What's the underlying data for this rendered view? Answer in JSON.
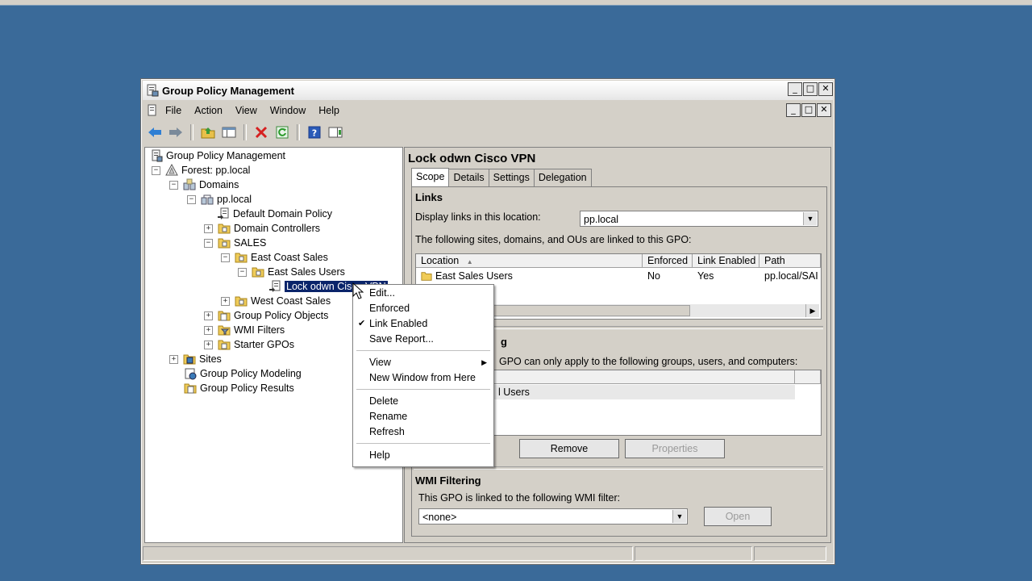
{
  "window": {
    "title": "Group Policy Management",
    "min": "_",
    "max": "□",
    "close": "✕"
  },
  "menu": {
    "items": [
      "File",
      "Action",
      "View",
      "Window",
      "Help"
    ]
  },
  "tree": {
    "root": "Group Policy Management",
    "forest": "Forest: pp.local",
    "domains": "Domains",
    "domain": "pp.local",
    "default_policy": "Default Domain Policy",
    "domain_controllers": "Domain Controllers",
    "sales": "SALES",
    "east_coast": "East Coast Sales",
    "east_users": "East Sales Users",
    "selected_gpo": "Lock odwn Cisco VPN",
    "west_coast": "West Coast Sales",
    "gpo_objects": "Group Policy Objects",
    "wmi_filters": "WMI Filters",
    "starter_gpos": "Starter GPOs",
    "sites": "Sites",
    "modeling": "Group Policy Modeling",
    "results": "Group Policy Results",
    "expanders": {
      "minus": "−",
      "plus": "+"
    }
  },
  "detail": {
    "title": "Lock odwn Cisco VPN",
    "tabs": [
      "Scope",
      "Details",
      "Settings",
      "Delegation"
    ],
    "links": {
      "heading": "Links",
      "display_label": "Display links in this location:",
      "location_value": "pp.local",
      "info": "The following sites, domains, and OUs are linked to this GPO:",
      "columns": [
        "Location",
        "Enforced",
        "Link Enabled",
        "Path"
      ],
      "rows": [
        {
          "location": "East Sales Users",
          "enforced": "No",
          "link_enabled": "Yes",
          "path": "pp.local/SAI"
        }
      ]
    },
    "security": {
      "heading_partial": "g",
      "info_partial": "GPO can only apply to the following groups, users, and computers:",
      "row_partial": "l Users",
      "remove": "Remove",
      "properties": "Properties"
    },
    "wmi": {
      "heading": "WMI Filtering",
      "info": "This GPO is linked to the following WMI filter:",
      "value": "<none>",
      "open": "Open"
    }
  },
  "context_menu": {
    "items": [
      {
        "label": "Edit...",
        "checked": false
      },
      {
        "label": "Enforced",
        "checked": false
      },
      {
        "label": "Link Enabled",
        "checked": true
      },
      {
        "label": "Save Report...",
        "checked": false
      },
      {
        "label": "View",
        "submenu": true
      },
      {
        "label": "New Window from Here"
      },
      {
        "label": "Delete"
      },
      {
        "label": "Rename"
      },
      {
        "label": "Refresh"
      },
      {
        "label": "Help"
      }
    ],
    "check_glyph": "✔",
    "submenu_glyph": "▶"
  }
}
